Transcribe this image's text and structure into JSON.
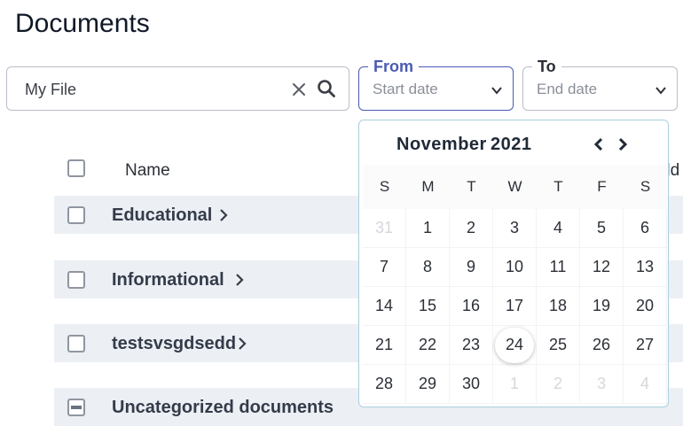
{
  "page": {
    "title": "Documents"
  },
  "search": {
    "value": "My File"
  },
  "filters": {
    "from": {
      "legend": "From",
      "placeholder": "Start date"
    },
    "to": {
      "legend": "To",
      "placeholder": "End date"
    }
  },
  "table": {
    "columns": {
      "name": "Name",
      "added_partial": "dd"
    }
  },
  "folders": [
    {
      "name": "Educational",
      "state": "unchecked"
    },
    {
      "name": "Informational",
      "state": "unchecked"
    },
    {
      "name": "testsvsgdsedd",
      "state": "unchecked"
    },
    {
      "name": "Uncategorized documents",
      "state": "indeterminate"
    }
  ],
  "calendar": {
    "month": "November",
    "year": "2021",
    "prev_icon": "‹",
    "next_icon": "›",
    "weekdays": [
      "S",
      "M",
      "T",
      "W",
      "T",
      "F",
      "S"
    ],
    "weeks": [
      [
        "31",
        "1",
        "2",
        "3",
        "4",
        "5",
        "6"
      ],
      [
        "7",
        "8",
        "9",
        "10",
        "11",
        "12",
        "13"
      ],
      [
        "14",
        "15",
        "16",
        "17",
        "18",
        "19",
        "20"
      ],
      [
        "21",
        "22",
        "23",
        "24",
        "25",
        "26",
        "27"
      ],
      [
        "28",
        "29",
        "30",
        "1",
        "2",
        "3",
        "4"
      ]
    ],
    "today": "24"
  },
  "colors": {
    "accent": "#4a5ab3",
    "row_background": "#eceff3",
    "calendar_border": "#a9cfe0",
    "muted_day": "#d4d7dc"
  }
}
